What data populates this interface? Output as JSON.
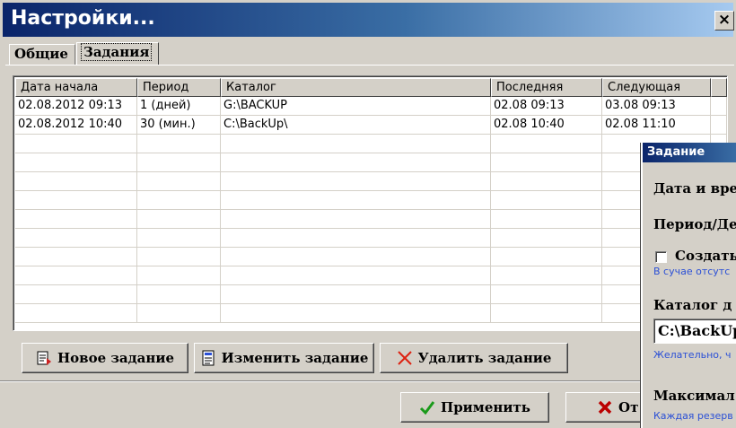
{
  "window": {
    "title": "Настройки...",
    "close_label": "×"
  },
  "tabs": [
    {
      "label": "Общие",
      "active": false
    },
    {
      "label": "Задания",
      "active": true
    }
  ],
  "table": {
    "columns": [
      "Дата начала",
      "Период",
      "Каталог",
      "Последняя",
      "Следующая"
    ],
    "rows": [
      [
        "02.08.2012 09:13",
        "1 (дней)",
        "G:\\BACKUP",
        "02.08 09:13",
        "03.08 09:13"
      ],
      [
        "02.08.2012 10:40",
        "30 (мин.)",
        "C:\\BackUp\\",
        "02.08 10:40",
        "02.08 11:10"
      ]
    ]
  },
  "buttons": {
    "new_task": "Новое задание",
    "edit_task": "Изменить задание",
    "delete_task": "Удалить задание",
    "apply": "Применить",
    "cancel": "От"
  },
  "icons": {
    "new_task": "new-document-icon",
    "edit_task": "edit-document-icon",
    "delete_task": "red-cross-icon",
    "apply": "green-check-icon",
    "cancel": "red-x-icon"
  },
  "task_dialog": {
    "title": "Задание",
    "datetime_label": "Дата и вре",
    "period_label": "Период/Де",
    "create_label": "Создать",
    "create_hint": "В сучае отсутс",
    "folder_label": "Каталог д",
    "folder_value": "C:\\BackUp",
    "folder_hint": "Желательно, ч",
    "max_label": "Максимал",
    "max_hint": "Каждая резерв"
  },
  "colors": {
    "title_gradient_start": "#0a246a",
    "title_gradient_end": "#a6caf0",
    "hint_blue": "#2a4fd6",
    "face": "#d4d0c8"
  }
}
